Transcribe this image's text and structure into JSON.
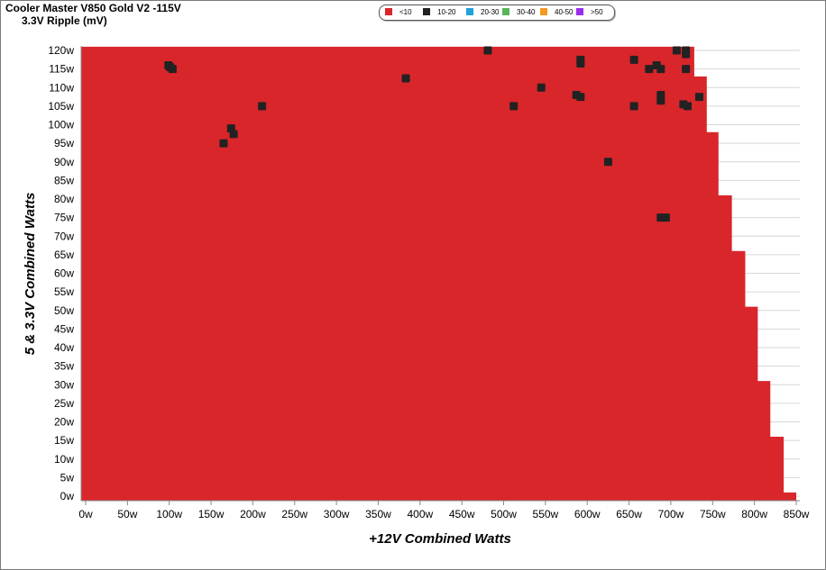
{
  "chart_data": {
    "type": "heatmap",
    "title": "Cooler Master V850 Gold V2 -115V",
    "subtitle": "3.3V Ripple (mV)",
    "xlabel": "+12V Combined Watts",
    "ylabel": "5 & 3.3V Combined Watts",
    "xlim": [
      0,
      850
    ],
    "ylim": [
      0,
      120
    ],
    "x_ticks": [
      "0w",
      "50w",
      "100w",
      "150w",
      "200w",
      "250w",
      "300w",
      "350w",
      "400w",
      "450w",
      "500w",
      "550w",
      "600w",
      "650w",
      "700w",
      "750w",
      "800w",
      "850w"
    ],
    "y_ticks": [
      "0w",
      "5w",
      "10w",
      "15w",
      "20w",
      "25w",
      "30w",
      "35w",
      "40w",
      "45w",
      "50w",
      "55w",
      "60w",
      "65w",
      "70w",
      "75w",
      "80w",
      "85w",
      "90w",
      "95w",
      "100w",
      "105w",
      "110w",
      "115w",
      "120w"
    ],
    "grid": true,
    "legend_position": "top",
    "legend": [
      {
        "label": "<10",
        "color": "#d9262b"
      },
      {
        "label": "10-20",
        "color": "#222222"
      },
      {
        "label": "20-30",
        "color": "#1ea3dc"
      },
      {
        "label": "30-40",
        "color": "#59b45a"
      },
      {
        "label": "40-50",
        "color": "#f39a21"
      },
      {
        "label": ">50",
        "color": "#9b2cf0"
      }
    ],
    "dominant_bin": "<10",
    "load_boundary": [
      {
        "y_range": [
          0,
          1
        ],
        "max_x": 850
      },
      {
        "y_range": [
          1,
          16
        ],
        "max_x": 835
      },
      {
        "y_range": [
          16,
          31
        ],
        "max_x": 819
      },
      {
        "y_range": [
          31,
          51
        ],
        "max_x": 804
      },
      {
        "y_range": [
          51,
          66
        ],
        "max_x": 789
      },
      {
        "y_range": [
          66,
          81
        ],
        "max_x": 773
      },
      {
        "y_range": [
          81,
          98
        ],
        "max_x": 757
      },
      {
        "y_range": [
          98,
          113
        ],
        "max_x": 743
      },
      {
        "y_range": [
          113,
          121
        ],
        "max_x": 728
      }
    ],
    "points_10_20": [
      {
        "x": 99,
        "y": 116
      },
      {
        "x": 101,
        "y": 115.5
      },
      {
        "x": 104,
        "y": 115
      },
      {
        "x": 165,
        "y": 95
      },
      {
        "x": 174,
        "y": 99
      },
      {
        "x": 177,
        "y": 97.5
      },
      {
        "x": 211,
        "y": 105
      },
      {
        "x": 383,
        "y": 112.5
      },
      {
        "x": 481,
        "y": 120
      },
      {
        "x": 512,
        "y": 105
      },
      {
        "x": 545,
        "y": 110
      },
      {
        "x": 587,
        "y": 108
      },
      {
        "x": 592,
        "y": 107.5
      },
      {
        "x": 592,
        "y": 116.5
      },
      {
        "x": 592,
        "y": 117.5
      },
      {
        "x": 625,
        "y": 90
      },
      {
        "x": 656,
        "y": 105
      },
      {
        "x": 656,
        "y": 117.5
      },
      {
        "x": 674,
        "y": 115
      },
      {
        "x": 683,
        "y": 116
      },
      {
        "x": 688,
        "y": 115
      },
      {
        "x": 688,
        "y": 75
      },
      {
        "x": 694,
        "y": 75
      },
      {
        "x": 688,
        "y": 108
      },
      {
        "x": 688,
        "y": 106.5
      },
      {
        "x": 707,
        "y": 120
      },
      {
        "x": 718,
        "y": 120
      },
      {
        "x": 718,
        "y": 119
      },
      {
        "x": 718,
        "y": 115
      },
      {
        "x": 715,
        "y": 105.5
      },
      {
        "x": 720,
        "y": 105
      },
      {
        "x": 734,
        "y": 107.5
      }
    ]
  }
}
